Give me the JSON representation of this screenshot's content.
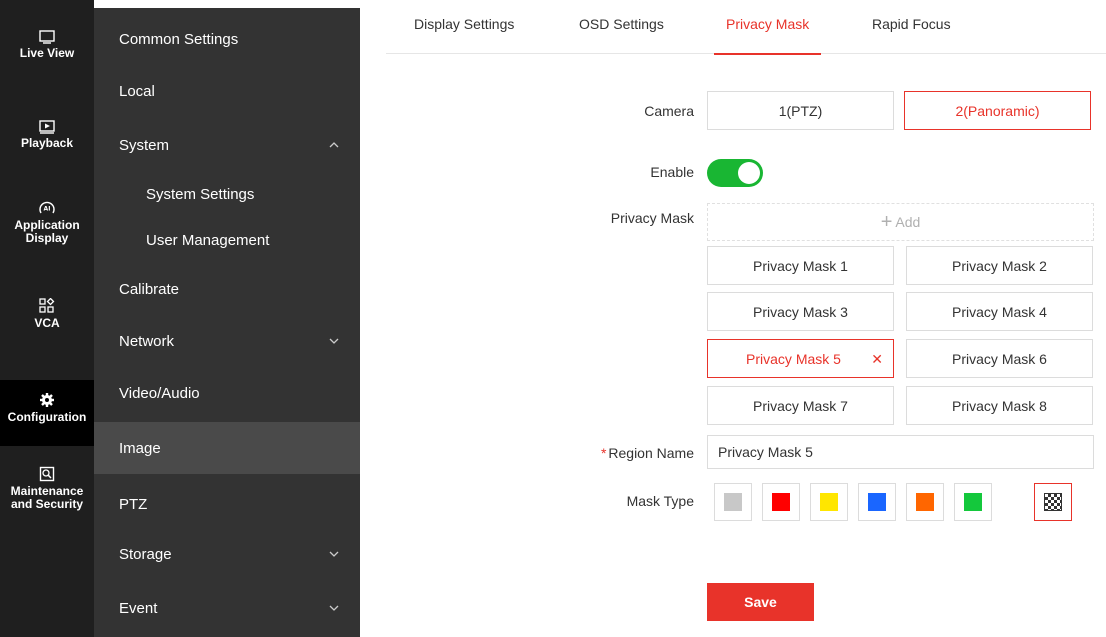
{
  "rail": {
    "items": [
      {
        "label": "Live View"
      },
      {
        "label": "Playback"
      },
      {
        "label": "Application Display"
      },
      {
        "label": "VCA"
      },
      {
        "label": "Configuration"
      },
      {
        "label": "Maintenance and Security"
      }
    ]
  },
  "menu": {
    "items": [
      {
        "label": "Common Settings"
      },
      {
        "label": "Local"
      },
      {
        "label": "System"
      },
      {
        "label": "System Settings"
      },
      {
        "label": "User Management"
      },
      {
        "label": "Calibrate"
      },
      {
        "label": "Network"
      },
      {
        "label": "Video/Audio"
      },
      {
        "label": "Image"
      },
      {
        "label": "PTZ"
      },
      {
        "label": "Storage"
      },
      {
        "label": "Event"
      }
    ]
  },
  "tabs": [
    {
      "label": "Display Settings"
    },
    {
      "label": "OSD Settings"
    },
    {
      "label": "Privacy Mask"
    },
    {
      "label": "Rapid Focus"
    }
  ],
  "form": {
    "camera_label": "Camera",
    "camera_options": [
      "1(PTZ)",
      "2(Panoramic)"
    ],
    "enable_label": "Enable",
    "privacy_mask_label": "Privacy Mask",
    "add_label": "Add",
    "masks": [
      "Privacy Mask 1",
      "Privacy Mask 2",
      "Privacy Mask 3",
      "Privacy Mask 4",
      "Privacy Mask 5",
      "Privacy Mask 6",
      "Privacy Mask 7",
      "Privacy Mask 8"
    ],
    "region_name_label": "Region Name",
    "region_name_value": "Privacy Mask 5",
    "mask_type_label": "Mask Type",
    "mask_colors": [
      "#c8c8c8",
      "#ff0000",
      "#ffe600",
      "#1a66ff",
      "#ff6600",
      "#14c83c",
      "mosaic"
    ],
    "save_label": "Save"
  },
  "colors": {
    "accent": "#e8332a",
    "toggle_on": "#19b633"
  }
}
